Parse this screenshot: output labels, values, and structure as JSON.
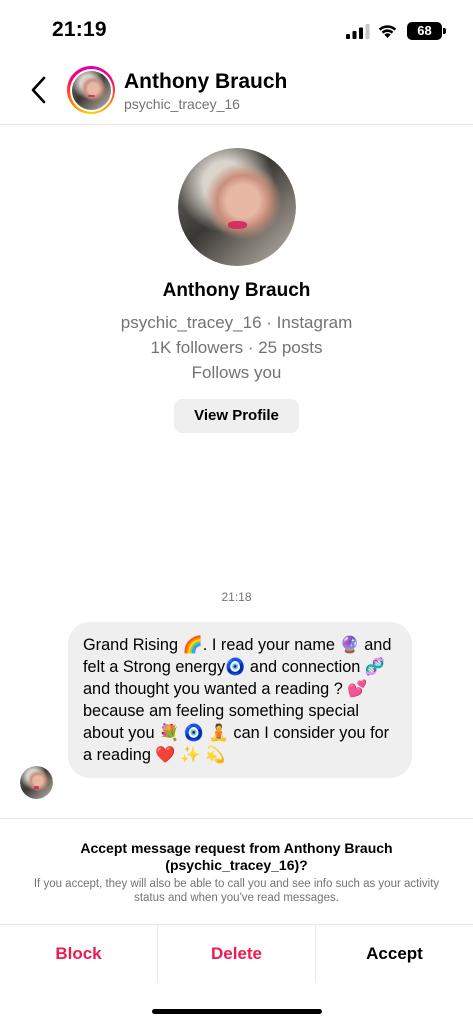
{
  "status_bar": {
    "time": "21:19",
    "battery": "68",
    "signal_icon": "cellular-signal-icon",
    "wifi_icon": "wifi-icon"
  },
  "header": {
    "back_icon": "chevron-left-icon",
    "name": "Anthony Brauch",
    "username": "psychic_tracey_16"
  },
  "profile": {
    "name": "Anthony Brauch",
    "subtitle": "psychic_tracey_16 · Instagram",
    "stats": "1K followers · 25 posts",
    "relation": "Follows you",
    "view_profile_label": "View Profile"
  },
  "conversation": {
    "timestamp": "21:18",
    "message": "Grand Rising 🌈. I read your name 🔮 and felt a Strong energy🧿 and connection 🧬 and thought you wanted a reading ? 💕because am feeling something special about you 💐 🧿 🧘 can I consider you for a reading ❤️ ✨ 💫"
  },
  "request": {
    "title": "Accept message request from Anthony Brauch (psychic_tracey_16)?",
    "subtitle": "If you accept, they will also be able to call you and see info such as your activity status and when you've read messages."
  },
  "actions": {
    "block": "Block",
    "delete": "Delete",
    "accept": "Accept"
  },
  "colors": {
    "danger": "#ed1b50",
    "bubble": "#efefef",
    "secondary_text": "#737373"
  }
}
